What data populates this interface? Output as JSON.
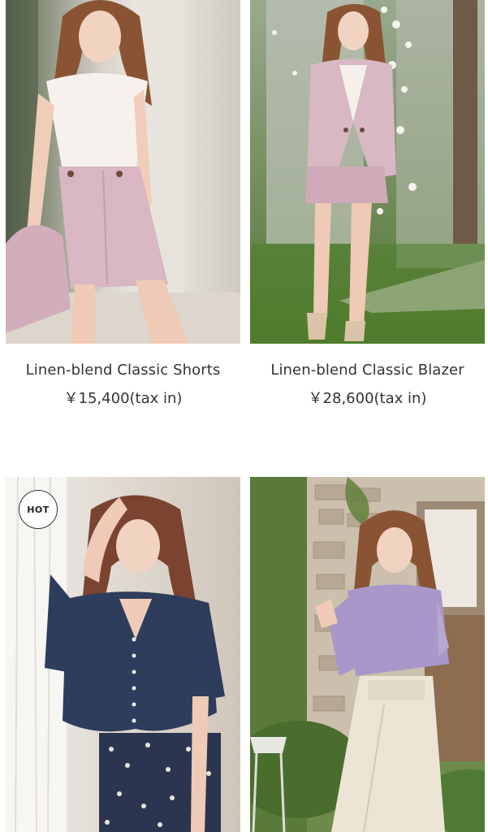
{
  "products": [
    {
      "name": "Linen-blend Classic Shorts",
      "price": "￥15,400(tax in)",
      "photo_icon": "model-photo",
      "badge": ""
    },
    {
      "name": "Linen-blend Classic Blazer",
      "price": "￥28,600(tax in)",
      "photo_icon": "model-photo",
      "badge": ""
    },
    {
      "name": "",
      "price": "",
      "photo_icon": "model-photo",
      "badge": "HOT"
    },
    {
      "name": "",
      "price": "",
      "photo_icon": "model-photo",
      "badge": ""
    }
  ],
  "colors": {
    "text": "#333333",
    "background": "#ffffff",
    "pink": "#d7b8c3",
    "navy": "#2f3d5c",
    "lavender": "#a997c9",
    "grass": "#4f7d2b"
  }
}
